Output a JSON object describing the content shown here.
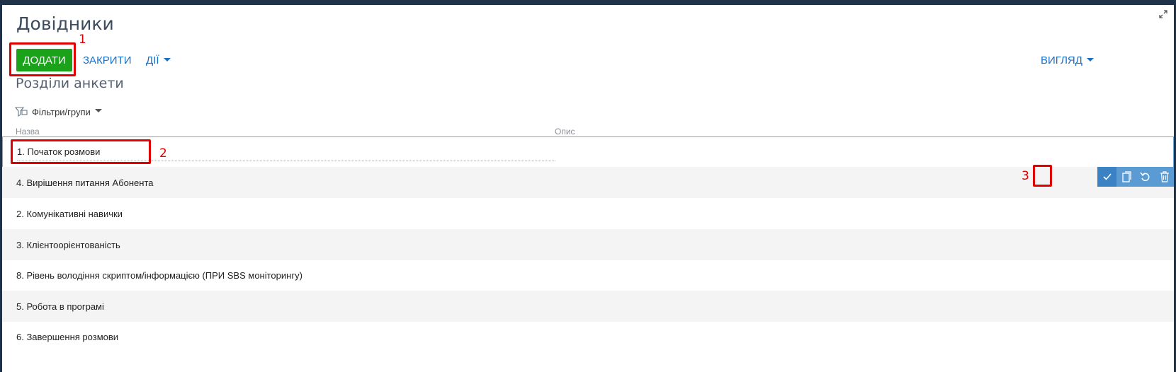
{
  "header": {
    "title": "Довідники"
  },
  "toolbar": {
    "add_label": "ДОДАТИ",
    "close_label": "ЗАКРИТИ",
    "actions_label": "ДІЇ",
    "view_label": "ВИГЛЯД"
  },
  "section": {
    "title": "Розділи анкети"
  },
  "filters": {
    "label": "Фільтри/групи"
  },
  "table": {
    "columns": [
      "Назва",
      "Опис"
    ],
    "editing_row": {
      "name": "1. Початок розмови"
    },
    "rows": [
      {
        "name": "4. Вирішення питання Абонента"
      },
      {
        "name": "2. Комунікативні навички"
      },
      {
        "name": "3. Клієнтоорієнтованість"
      },
      {
        "name": "8. Рівень володіння скриптом/інформацією (ПРИ SBS моніторингу)"
      },
      {
        "name": "5. Робота в програмі"
      },
      {
        "name": "6. Завершення розмови"
      }
    ]
  },
  "annotations": {
    "a1": "1",
    "a2": "2",
    "a3": "3"
  },
  "colors": {
    "accent": "#1c6fc7",
    "add_button": "#1aa31a",
    "annotation": "#e00000"
  },
  "icons": [
    "expand-icon",
    "filter-icon",
    "check-icon",
    "copy-icon",
    "undo-icon",
    "trash-icon"
  ]
}
